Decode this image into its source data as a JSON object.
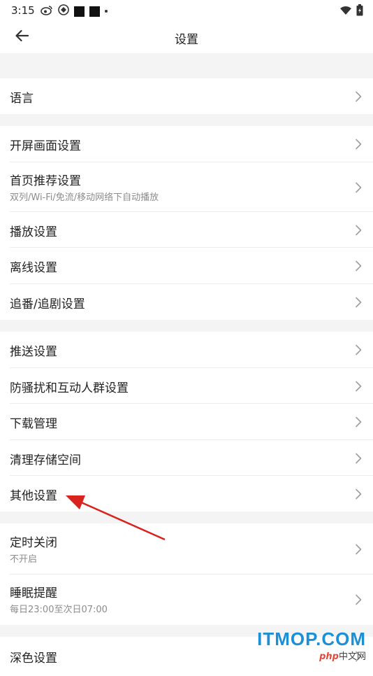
{
  "status_bar": {
    "time": "3:15",
    "left_icons": [
      "weibo-icon",
      "app-icon",
      "notification-square",
      "notification-square",
      "dot"
    ],
    "right_icons": [
      "wifi-icon",
      "battery-icon"
    ]
  },
  "header": {
    "title": "设置"
  },
  "sections": [
    {
      "items": [
        {
          "label": "语言"
        }
      ]
    },
    {
      "items": [
        {
          "label": "开屏画面设置"
        },
        {
          "label": "首页推荐设置",
          "sub": "双列/Wi-Fi/免流/移动网络下自动播放"
        },
        {
          "label": "播放设置"
        },
        {
          "label": "离线设置"
        },
        {
          "label": "追番/追剧设置"
        }
      ]
    },
    {
      "items": [
        {
          "label": "推送设置"
        },
        {
          "label": "防骚扰和互动人群设置"
        },
        {
          "label": "下载管理"
        },
        {
          "label": "清理存储空间"
        },
        {
          "label": "其他设置"
        }
      ]
    },
    {
      "items": [
        {
          "label": "定时关闭",
          "sub": "不开启"
        },
        {
          "label": "睡眠提醒",
          "sub": "每日23:00至次日07:00"
        }
      ]
    },
    {
      "items": [
        {
          "label": "深色设置"
        }
      ]
    }
  ],
  "watermark": {
    "main": "ITMOP.COM",
    "php": "php",
    "sub": "中文网"
  },
  "colors": {
    "annotation_arrow": "#d9231f",
    "watermark_blue": "#1d8fd6"
  }
}
